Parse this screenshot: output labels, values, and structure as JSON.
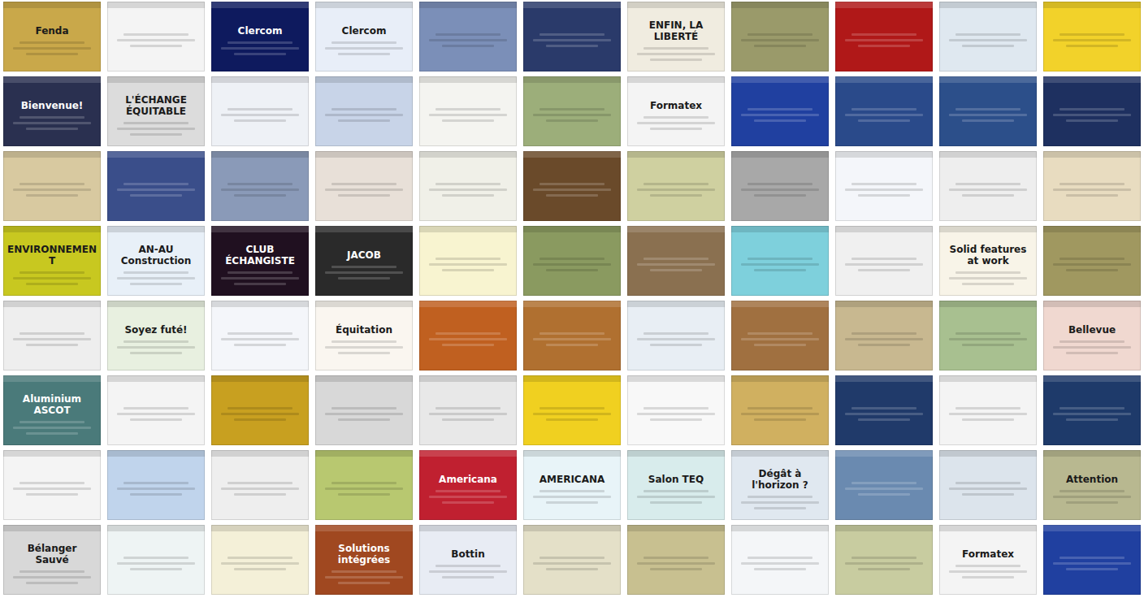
{
  "collage": {
    "rows": [
      {
        "tiles": [
          {
            "color": "#c9a84a",
            "title": "Fenda"
          },
          {
            "color": "#f4f4f4"
          },
          {
            "color": "#0e1a5e",
            "title": "Clercom"
          },
          {
            "color": "#e8eef8",
            "title": "Clercom"
          },
          {
            "color": "#7b8fb8"
          },
          {
            "color": "#2a3a6a"
          },
          {
            "color": "#f0ece0",
            "title": "ENFIN, LA LIBERTÉ"
          },
          {
            "color": "#9a9a6a"
          },
          {
            "color": "#b01818"
          },
          {
            "color": "#dfe8f0"
          },
          {
            "color": "#f2d22a"
          }
        ]
      },
      {
        "tiles": [
          {
            "color": "#2a3050",
            "title": "Bienvenue!"
          },
          {
            "color": "#dcdcdc",
            "title": "L'ÉCHANGE ÉQUITABLE"
          },
          {
            "color": "#eef1f6"
          },
          {
            "color": "#c8d4e8"
          },
          {
            "color": "#f4f4f0"
          },
          {
            "color": "#9cae7a"
          },
          {
            "color": "#f4f4f4",
            "title": "Formatex"
          },
          {
            "color": "#2040a0"
          },
          {
            "color": "#2a4a8a"
          },
          {
            "color": "#2c4f8a"
          },
          {
            "color": "#1e3060"
          }
        ]
      },
      {
        "tiles": [
          {
            "color": "#d8c9a0"
          },
          {
            "color": "#3a4e8a"
          },
          {
            "color": "#8a9ab8"
          },
          {
            "color": "#e8e0d8"
          },
          {
            "color": "#f0f0e8"
          },
          {
            "color": "#6a4a2a"
          },
          {
            "color": "#cfd0a0"
          },
          {
            "color": "#a8a8a8"
          },
          {
            "color": "#f4f6fa"
          },
          {
            "color": "#eeeeee"
          },
          {
            "color": "#e8dcc0"
          }
        ]
      },
      {
        "tiles": [
          {
            "color": "#c8c820",
            "title": "ENVIRONNEMENT"
          },
          {
            "color": "#e8f0f8",
            "title": "AN-AU Construction"
          },
          {
            "color": "#201020",
            "title": "CLUB ÉCHANGISTE"
          },
          {
            "color": "#2a2a2a",
            "title": "JACOB"
          },
          {
            "color": "#f8f4d0"
          },
          {
            "color": "#8a9a60"
          },
          {
            "color": "#8a7050"
          },
          {
            "color": "#7ed0dc"
          },
          {
            "color": "#f0f0f0"
          },
          {
            "color": "#f8f4e8",
            "title": "Solid features at work"
          },
          {
            "color": "#a09860"
          }
        ]
      },
      {
        "tiles": [
          {
            "color": "#eeeeee"
          },
          {
            "color": "#e8f0e0",
            "title": "Soyez futé!"
          },
          {
            "color": "#f4f6fa"
          },
          {
            "color": "#faf6f0",
            "title": "Équitation"
          },
          {
            "color": "#c06020"
          },
          {
            "color": "#b07030"
          },
          {
            "color": "#e8eef4"
          },
          {
            "color": "#a07040"
          },
          {
            "color": "#c8b890"
          },
          {
            "color": "#a8c090"
          },
          {
            "color": "#f0d8d0",
            "title": "Bellevue"
          }
        ]
      },
      {
        "tiles": [
          {
            "color": "#4a7a7a",
            "title": "Aluminium ASCOT"
          },
          {
            "color": "#f4f4f4"
          },
          {
            "color": "#c8a020"
          },
          {
            "color": "#d8d8d8"
          },
          {
            "color": "#e8e8e8"
          },
          {
            "color": "#f0d020"
          },
          {
            "color": "#f8f8f8"
          },
          {
            "color": "#d0b060"
          },
          {
            "color": "#203a6a"
          },
          {
            "color": "#f4f4f4"
          },
          {
            "color": "#1e3a6a"
          }
        ]
      },
      {
        "tiles": [
          {
            "color": "#f4f4f4"
          },
          {
            "color": "#c0d4ec"
          },
          {
            "color": "#eeeeee"
          },
          {
            "color": "#b8c870"
          },
          {
            "color": "#c02030",
            "title": "Americana"
          },
          {
            "color": "#e8f4f8",
            "title": "AMERICANA"
          },
          {
            "color": "#d8ecec",
            "title": "Salon TEQ"
          },
          {
            "color": "#e0e8f0",
            "title": "Dégât à l'horizon ?"
          },
          {
            "color": "#6a8ab0"
          },
          {
            "color": "#dce4ec"
          },
          {
            "color": "#b8b890",
            "title": "Attention"
          }
        ]
      },
      {
        "tiles": [
          {
            "color": "#d8d8d8",
            "title": "Bélanger Sauvé"
          },
          {
            "color": "#eef4f4"
          },
          {
            "color": "#f4f0d8"
          },
          {
            "color": "#a04820",
            "title": "Solutions intégrées"
          },
          {
            "color": "#e8ecf4",
            "title": "Bottin"
          },
          {
            "color": "#e4e0c8"
          },
          {
            "color": "#c8c090"
          },
          {
            "color": "#f4f6f8"
          },
          {
            "color": "#c8cca0"
          },
          {
            "color": "#f4f4f4",
            "title": "Formatex"
          },
          {
            "color": "#2040a0"
          }
        ]
      }
    ]
  }
}
